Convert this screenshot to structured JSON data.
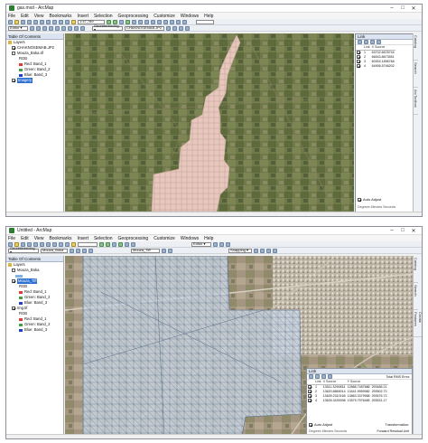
{
  "window1": {
    "title": "gas.mxd - ArcMap",
    "menu": [
      "File",
      "Edit",
      "View",
      "Bookmarks",
      "Insert",
      "Selection",
      "Geoprocessing",
      "Customize",
      "Windows",
      "Help"
    ],
    "editor_label": "Editor ▾",
    "scale": "1:47,789",
    "georef_label": "Georeferencing ▾",
    "georef_layer": "CHAKNOSEMAB.JP2",
    "toc_title": "Table Of Contents",
    "toc": [
      "Layers",
      "CHAKNOSEMAB.JP2",
      "Mouza_Boka.tif",
      "RGB",
      "Red: Band_1",
      "Green: Band_2",
      "Blue: Band_3",
      "Imagery"
    ],
    "link_title": "Link",
    "link_headers": [
      "Link",
      "X Source"
    ],
    "link_rows": [
      [
        "1",
        "63702.6678744"
      ],
      [
        "2",
        "66543.8673551"
      ],
      [
        "3",
        "60304.1896768"
      ],
      [
        "4",
        "64906.5746202"
      ]
    ],
    "auto_adjust": "Auto Adjust",
    "units": "Degrees Minutes Seconds",
    "side_tabs": [
      "Catalog",
      "Search",
      "ArcToolbox"
    ]
  },
  "window2": {
    "title": "Untitled - ArcMap",
    "menu": [
      "File",
      "Edit",
      "View",
      "Bookmarks",
      "Insert",
      "Selection",
      "Geoprocessing",
      "Customize",
      "Windows",
      "Help"
    ],
    "editor_label": "Editor ▾",
    "snapping_label": "Snapping ▾",
    "georef_label": "Georeferencing ▾",
    "georef_layer": "Mouza_Boka",
    "georef_layer2": "Mouza_Tiff",
    "toc_title": "Table Of Contents",
    "toc": [
      "Layers",
      "Mouza_Boka",
      "Mouza_Tiff",
      "RGB",
      "Red: Band_1",
      "Green: Band_2",
      "Blue: Band_3",
      "Img.tif",
      "RGB",
      "Red: Band_1",
      "Green: Band_2",
      "Blue: Band_3"
    ],
    "link_title": "Link",
    "rms": "Total RMS Error:",
    "link_headers": [
      "Link",
      "X Source",
      "Y Source"
    ],
    "link_rows": [
      [
        "1",
        "13511.3290834",
        "12888.7487686",
        "293486.21"
      ],
      [
        "2",
        "13620.8869014",
        "13441.9959982",
        "293502.73"
      ],
      [
        "3",
        "13639.2310165",
        "13863.3379958",
        "293576.73"
      ],
      [
        "4",
        "13639.3439398",
        "13579.7576465",
        "293531.17"
      ]
    ],
    "auto_adjust": "Auto Adjust",
    "transformation_label": "Transformation:",
    "transformation": "Forward Residual Unit",
    "units": "Degrees Minutes Seconds",
    "side_tabs": [
      "Catalog",
      "Search",
      "Create Features"
    ]
  }
}
